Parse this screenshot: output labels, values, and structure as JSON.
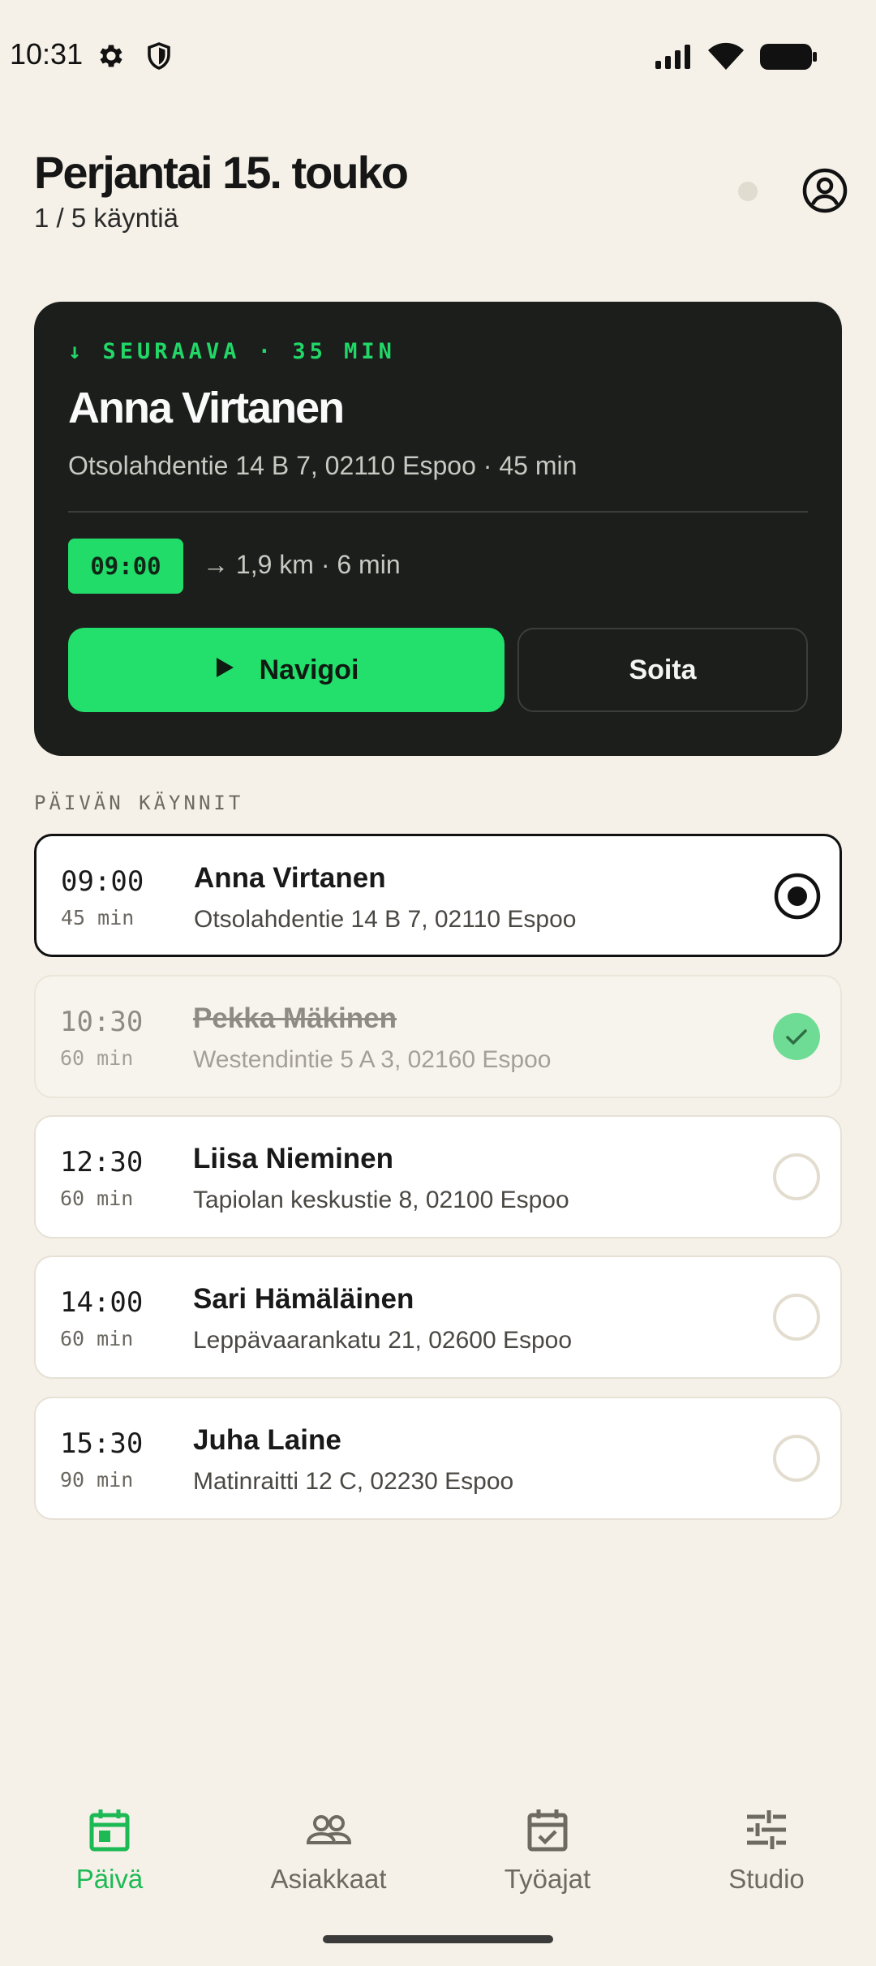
{
  "status_bar": {
    "time": "10:31"
  },
  "header": {
    "title": "Perjantai 15. touko",
    "subtitle": "1 / 5 käyntiä"
  },
  "next_visit": {
    "label": "↓ SEURAAVA · 35 MIN",
    "name": "Anna Virtanen",
    "address": "Otsolahdentie 14 B 7, 02110 Espoo · 45 min",
    "time": "09:00",
    "route": "→ 1,9 km · 6 min",
    "navigate_label": "Navigoi",
    "call_label": "Soita"
  },
  "visits_section": {
    "label": "PÄIVÄN KÄYNNIT",
    "visits": [
      {
        "time": "09:00",
        "duration": "45 min",
        "name": "Anna Virtanen",
        "address": "Otsolahdentie 14 B 7, 02110 Espoo",
        "status": "current"
      },
      {
        "time": "10:30",
        "duration": "60 min",
        "name": "Pekka Mäkinen",
        "address": "Westendintie 5 A 3, 02160 Espoo",
        "status": "done"
      },
      {
        "time": "12:30",
        "duration": "60 min",
        "name": "Liisa Nieminen",
        "address": "Tapiolan keskustie 8, 02100 Espoo",
        "status": "pending"
      },
      {
        "time": "14:00",
        "duration": "60 min",
        "name": "Sari Hämäläinen",
        "address": "Leppävaarankatu 21, 02600 Espoo",
        "status": "pending"
      },
      {
        "time": "15:30",
        "duration": "90 min",
        "name": "Juha Laine",
        "address": "Matinraitti 12 C, 02230 Espoo",
        "status": "pending"
      }
    ]
  },
  "bottom_nav": {
    "items": [
      {
        "label": "Päivä",
        "icon": "calendar-icon",
        "active": true
      },
      {
        "label": "Asiakkaat",
        "icon": "people-icon",
        "active": false
      },
      {
        "label": "Työajat",
        "icon": "calendar-check-icon",
        "active": false
      },
      {
        "label": "Studio",
        "icon": "sliders-icon",
        "active": false
      }
    ]
  },
  "colors": {
    "background": "#f5f1e8",
    "accent": "#22e06b",
    "card_dark": "#1b1e1b",
    "done_check": "#6fdc95"
  }
}
